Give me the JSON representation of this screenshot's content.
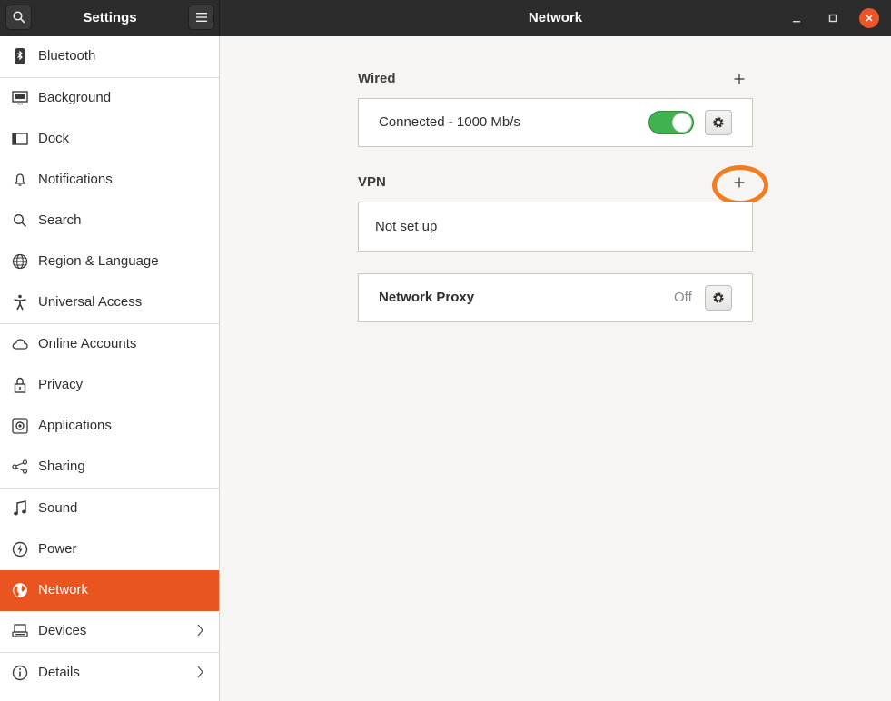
{
  "header": {
    "app_title": "Settings",
    "page_title": "Network"
  },
  "sidebar": {
    "items": [
      {
        "label": "Bluetooth",
        "icon": "bluetooth-icon"
      },
      {
        "label": "Background",
        "icon": "monitor-icon"
      },
      {
        "label": "Dock",
        "icon": "dock-icon"
      },
      {
        "label": "Notifications",
        "icon": "bell-icon"
      },
      {
        "label": "Search",
        "icon": "search-icon"
      },
      {
        "label": "Region & Language",
        "icon": "globe-icon"
      },
      {
        "label": "Universal Access",
        "icon": "accessibility-icon"
      },
      {
        "label": "Online Accounts",
        "icon": "cloud-icon"
      },
      {
        "label": "Privacy",
        "icon": "lock-icon"
      },
      {
        "label": "Applications",
        "icon": "apps-icon"
      },
      {
        "label": "Sharing",
        "icon": "share-icon"
      },
      {
        "label": "Sound",
        "icon": "music-note-icon"
      },
      {
        "label": "Power",
        "icon": "power-icon"
      },
      {
        "label": "Network",
        "icon": "network-globe-icon"
      },
      {
        "label": "Devices",
        "icon": "devices-icon"
      },
      {
        "label": "Details",
        "icon": "info-icon"
      }
    ],
    "active": "Network"
  },
  "wired": {
    "title": "Wired",
    "status": "Connected - 1000 Mb/s",
    "toggle_on": true
  },
  "vpn": {
    "title": "VPN",
    "status": "Not set up"
  },
  "proxy": {
    "title": "Network Proxy",
    "state": "Off"
  },
  "colors": {
    "accent": "#e95420",
    "toggle_on": "#3eb34f",
    "highlight": "#f57c1f",
    "close_button": "#e9562a"
  }
}
